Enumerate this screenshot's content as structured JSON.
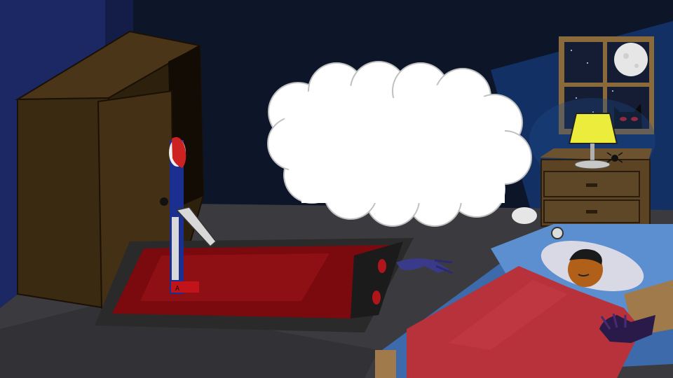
{
  "scene": {
    "name": "bedroom-night",
    "thought_bubble_text": "",
    "colors": {
      "wall": "#0d1629",
      "left_wall": "#1c2a63",
      "floor": "#3a3a3e",
      "wardrobe": "#3b2a12",
      "rug": "#7a0a0e",
      "blanket": "#b8323c",
      "bed_frame": "#5b8fd0",
      "lamp_shade": "#ecec3c",
      "nightstand": "#5b4323",
      "window_sky": "#141d33",
      "moon": "#e8e8e8",
      "creature_eyes": "#d11a1a"
    },
    "icons": [
      "moon-icon",
      "shadow-creature-icon",
      "clown-icon",
      "lamp-icon"
    ]
  }
}
